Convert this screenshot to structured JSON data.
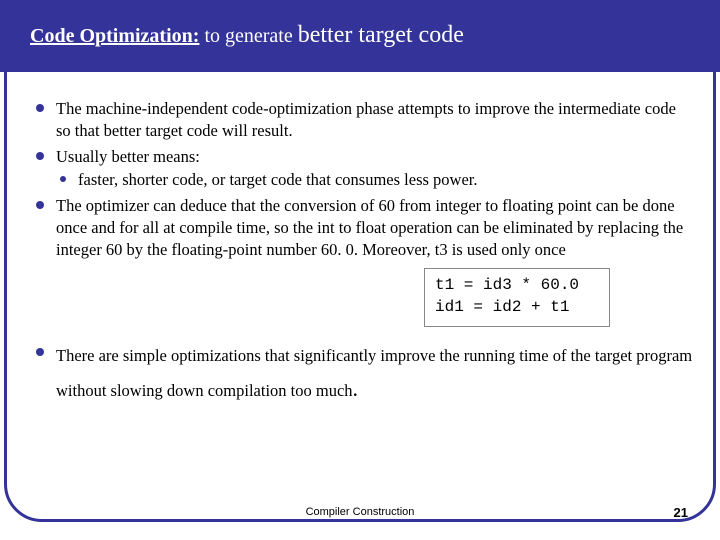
{
  "title": {
    "prefix_bold": "Code Optimization:",
    "middle": " to generate ",
    "suffix_big": "better target code"
  },
  "bullets": {
    "b1": "The machine-independent code-optimization phase attempts to improve the intermediate code so that better target code will result.",
    "b2": "Usually better means:",
    "b2_sub1": "faster, shorter code, or target code that consumes less power.",
    "b3": "The optimizer can deduce that the conversion of 60 from integer to floating point can be done once and for all at compile time, so the int to float operation can be eliminated by replacing the integer 60 by the floating-point number 60. 0. Moreover, t3 is used only once",
    "b4": "There are simple optimizations that significantly improve the running time of the target program without slowing down compilation too much",
    "b4_period": "."
  },
  "code": {
    "line1": "t1 = id3 * 60.0",
    "line2": "id1 = id2 + t1"
  },
  "footer": {
    "title": "Compiler Construction",
    "page": "21"
  }
}
